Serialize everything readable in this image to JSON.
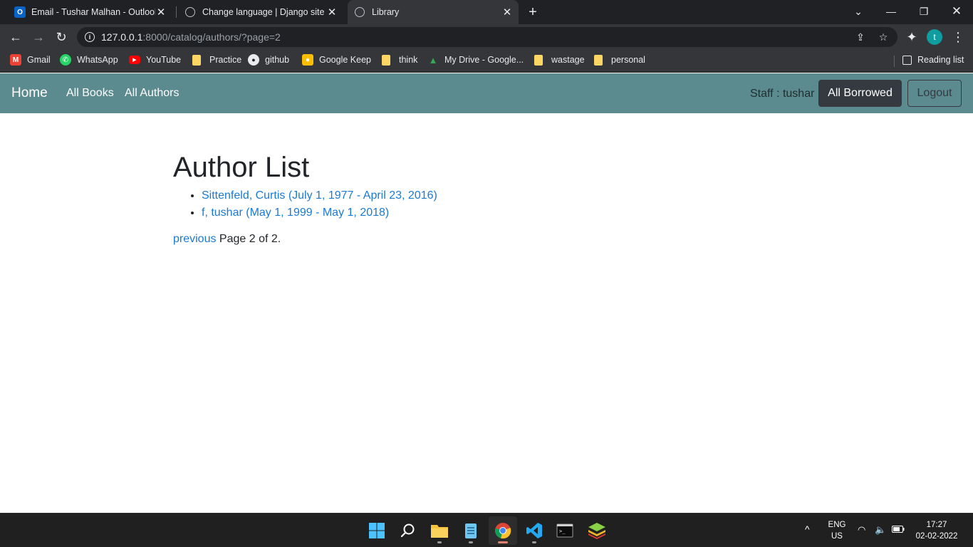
{
  "browser": {
    "tabs": [
      {
        "title": "Email - Tushar Malhan - Outlook",
        "icon": "outlook-icon",
        "active": false
      },
      {
        "title": "Change language | Django site admin",
        "icon": "globe-icon",
        "active": false
      },
      {
        "title": "Library",
        "icon": "globe-icon",
        "active": true
      }
    ],
    "address": {
      "host": "127.0.0.1",
      "path": ":8000/catalog/authors/?page=2"
    },
    "profile_initial": "t",
    "bookmarks": [
      {
        "label": "Gmail",
        "icon": "gmail-icon"
      },
      {
        "label": "WhatsApp",
        "icon": "whatsapp-icon"
      },
      {
        "label": "YouTube",
        "icon": "youtube-icon"
      },
      {
        "label": "Practice",
        "icon": "folder-icon"
      },
      {
        "label": "github",
        "icon": "github-icon"
      },
      {
        "label": "Google Keep",
        "icon": "google-keep-icon"
      },
      {
        "label": "think",
        "icon": "folder-icon"
      },
      {
        "label": "My Drive - Google...",
        "icon": "google-drive-icon"
      },
      {
        "label": "wastage",
        "icon": "folder-icon"
      },
      {
        "label": "personal",
        "icon": "folder-icon"
      }
    ],
    "reading_list": "Reading list"
  },
  "site": {
    "brand": "Home",
    "nav": [
      "All Books",
      "All Authors"
    ],
    "staff_label": "Staff : tushar",
    "borrowed_button": "All Borrowed",
    "logout_button": "Logout",
    "brand_color": "#5b8a8f"
  },
  "page": {
    "heading": "Author List",
    "authors": [
      "Sittenfeld, Curtis (July 1, 1977 - April 23, 2016)",
      "f, tushar (May 1, 1999 - May 1, 2018)"
    ],
    "pager": {
      "previous": "previous",
      "status": " Page 2 of 2."
    }
  },
  "taskbar": {
    "apps": [
      "windows-start-icon",
      "search-icon",
      "file-explorer-icon",
      "notepad-icon",
      "chrome-icon",
      "vscode-icon",
      "terminal-icon",
      "bluestacks-icon"
    ],
    "lang_top": "ENG",
    "lang_bottom": "US",
    "time": "17:27",
    "date": "02-02-2022"
  }
}
